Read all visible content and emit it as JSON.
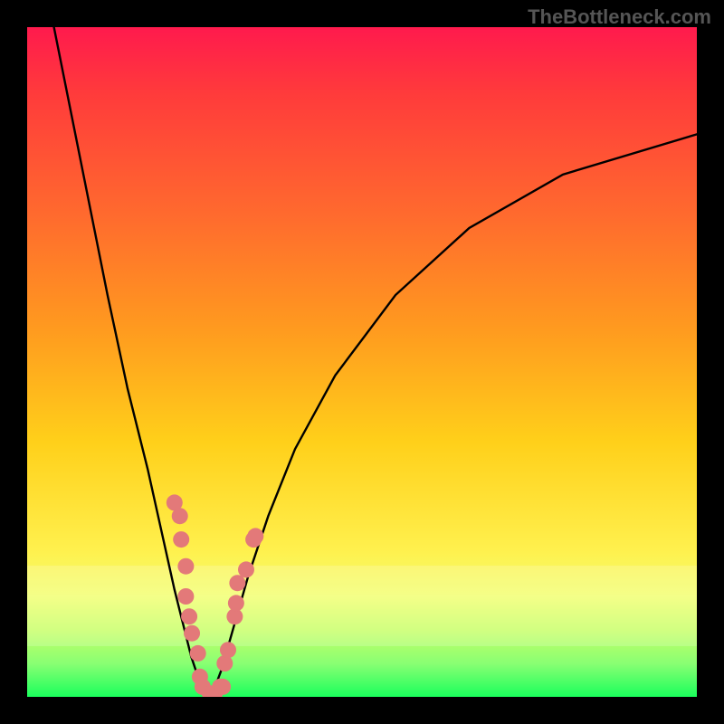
{
  "watermark": "TheBottleneck.com",
  "colors": {
    "frame": "#000000",
    "dot": "#e37979",
    "curve": "#000000",
    "gradient_top": "#ff1a4d",
    "gradient_bottom": "#1aff5c",
    "white_band": "rgba(255,255,255,0.18)"
  },
  "chart_data": {
    "type": "line",
    "title": "",
    "xlabel": "",
    "ylabel": "",
    "xlim": [
      0,
      100
    ],
    "ylim": [
      0,
      100
    ],
    "series": [
      {
        "name": "left-curve",
        "x": [
          4,
          8,
          12,
          15,
          18,
          20,
          22,
          23.5,
          24.5,
          25.5,
          26.5,
          27.5
        ],
        "y": [
          100,
          80,
          60,
          46,
          34,
          25,
          16,
          10,
          6,
          3,
          1,
          0
        ]
      },
      {
        "name": "right-curve",
        "x": [
          27.5,
          29,
          31,
          33,
          36,
          40,
          46,
          55,
          66,
          80,
          100
        ],
        "y": [
          0,
          4,
          11,
          18,
          27,
          37,
          48,
          60,
          70,
          78,
          84
        ]
      }
    ],
    "dots": {
      "name": "highlighted-points",
      "points": [
        {
          "x": 22.0,
          "y": 29.0
        },
        {
          "x": 22.8,
          "y": 27.0
        },
        {
          "x": 23.0,
          "y": 23.5
        },
        {
          "x": 23.7,
          "y": 19.5
        },
        {
          "x": 23.7,
          "y": 15.0
        },
        {
          "x": 24.2,
          "y": 12.0
        },
        {
          "x": 24.6,
          "y": 9.5
        },
        {
          "x": 25.5,
          "y": 6.5
        },
        {
          "x": 25.8,
          "y": 3.0
        },
        {
          "x": 26.2,
          "y": 1.5
        },
        {
          "x": 27.3,
          "y": 0.5
        },
        {
          "x": 28.0,
          "y": 0.5
        },
        {
          "x": 28.8,
          "y": 1.5
        },
        {
          "x": 29.2,
          "y": 1.5
        },
        {
          "x": 29.5,
          "y": 5.0
        },
        {
          "x": 30.0,
          "y": 7.0
        },
        {
          "x": 31.0,
          "y": 12.0
        },
        {
          "x": 31.2,
          "y": 14.0
        },
        {
          "x": 31.4,
          "y": 17.0
        },
        {
          "x": 32.7,
          "y": 19.0
        },
        {
          "x": 33.8,
          "y": 23.5
        },
        {
          "x": 34.1,
          "y": 24.0
        }
      ]
    }
  }
}
